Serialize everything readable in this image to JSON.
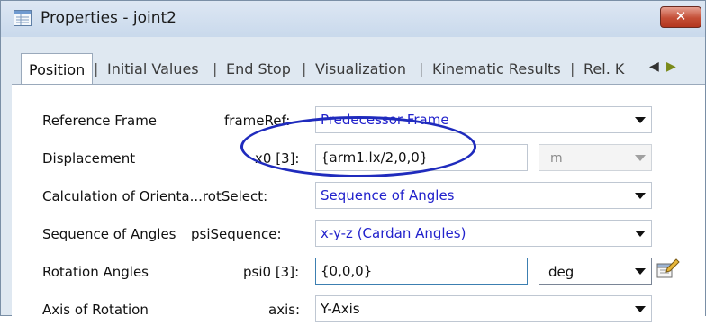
{
  "window": {
    "title": "Properties - joint2",
    "close_label": "✕"
  },
  "tabs": [
    {
      "label": "Position",
      "active": true
    },
    {
      "label": "Initial Values"
    },
    {
      "label": "End Stop"
    },
    {
      "label": "Visualization"
    },
    {
      "label": "Kinematic Results"
    },
    {
      "label": "Rel. K"
    }
  ],
  "tab_separator": "|",
  "tab_scroll": {
    "left": "◀",
    "right": "▶"
  },
  "rows": [
    {
      "label": "Reference Frame",
      "param": "frameRef:",
      "value": "Predecessor Frame",
      "kind": "combo"
    },
    {
      "label": "Displacement",
      "param": "x0 [3]:",
      "value": "{arm1.lx/2,0,0}",
      "kind": "text",
      "unit": "m"
    },
    {
      "label": "Calculation of Orienta...rotSelect:",
      "value": "Sequence of Angles",
      "kind": "combo"
    },
    {
      "label": "Sequence of Angles",
      "param": "psiSequence:",
      "value": "x-y-z (Cardan Angles)",
      "kind": "combo"
    },
    {
      "label": "Rotation Angles",
      "param": "psi0 [3]:",
      "value": "{0,0,0}",
      "kind": "text",
      "unit": "deg"
    },
    {
      "label": "Axis of Rotation",
      "param": "axis:",
      "value": "Y-Axis",
      "kind": "combo"
    }
  ],
  "colors": {
    "combo_text": "#2222cc",
    "highlight_ellipse": "#1f2bbd",
    "close_button": "#c44e36"
  },
  "icons": [
    "properties-window-icon",
    "close-icon",
    "edit-parameter-icon",
    "chevron-down-icon"
  ]
}
